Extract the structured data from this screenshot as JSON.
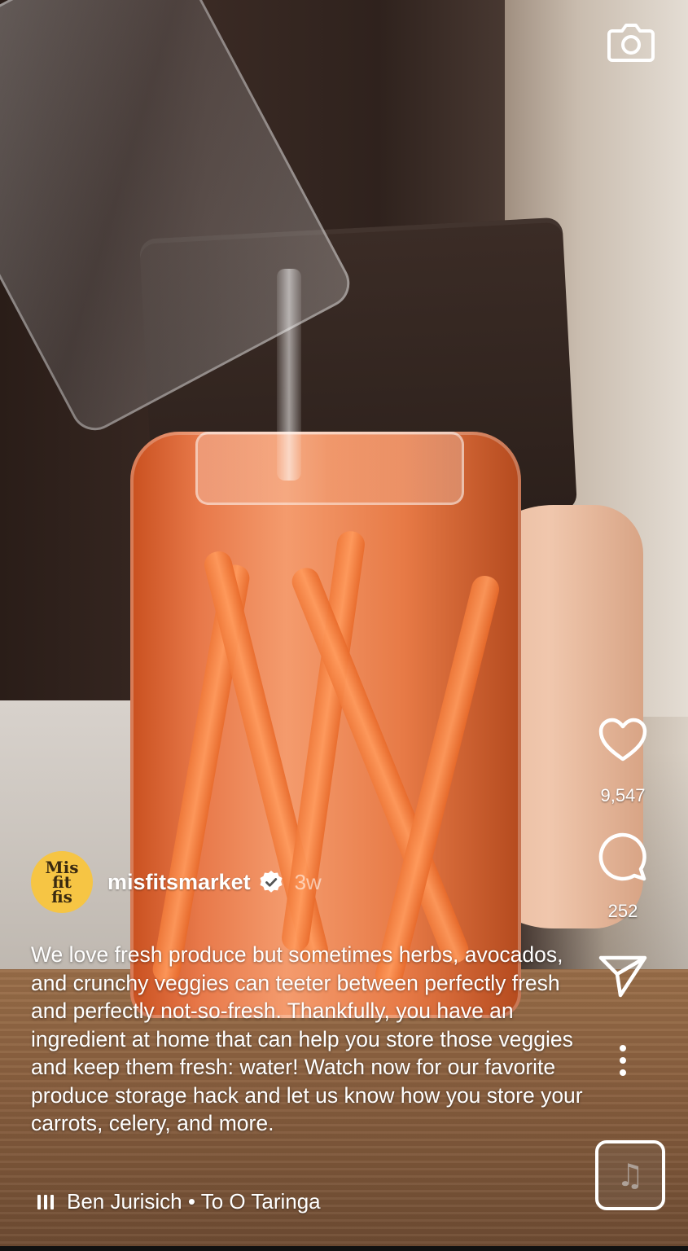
{
  "header": {
    "camera_icon": "camera-icon"
  },
  "post": {
    "author": {
      "username": "misfitsmarket",
      "avatar_text": "Mis fit fis",
      "verified": true,
      "time_ago": "3w"
    },
    "caption": "We love fresh produce but sometimes herbs, avocados, and crunchy veggies can teeter between perfectly fresh and perfectly not-so-fresh. Thankfully, you have an ingredient at home that can help you store those veggies and keep them fresh: water! Watch now for our favorite produce storage hack and let us know how you store your carrots, celery, and more.",
    "audio": {
      "text": "Ben Jurisich • To O Taringa"
    }
  },
  "actions": {
    "like": {
      "icon": "heart-icon",
      "count": "9,547"
    },
    "comment": {
      "icon": "comment-icon",
      "count": "252"
    },
    "share": {
      "icon": "send-icon"
    },
    "more": {
      "icon": "more-vertical-icon"
    },
    "audio_thumbnail": {
      "icon": "music-note-icon"
    }
  },
  "colors": {
    "avatar_bg": "#f6c544",
    "overlay_text": "#ffffff"
  }
}
